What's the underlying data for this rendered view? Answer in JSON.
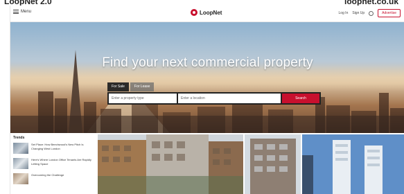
{
  "header": {
    "menu_label": "Menu",
    "brand": "LoopNet",
    "login": "Log In",
    "signup": "Sign Up",
    "advertise": "Advertise"
  },
  "hero": {
    "headline": "Find your next commercial property",
    "tabs": [
      {
        "label": "For Sale",
        "active": true
      },
      {
        "label": "For Lease",
        "active": false
      }
    ],
    "search": {
      "type_placeholder": "Enter a property type",
      "location_placeholder": "Enter a location",
      "button_label": "Search"
    }
  },
  "trends": {
    "title": "Trends",
    "items": [
      {
        "text": "Set Place: How Beechwood's New Pitch Is Changing West London"
      },
      {
        "text": "Here's Where London Office Tenants Are Rapidly Letting Space"
      },
      {
        "text": "Overcoming the Challenge"
      }
    ]
  },
  "colors": {
    "brand_red": "#c8102e",
    "hero_overlay_dark": "#222222"
  },
  "icons": {
    "menu": "hamburger-icon",
    "logo": "loopnet-logo-icon",
    "language": "globe-icon"
  }
}
